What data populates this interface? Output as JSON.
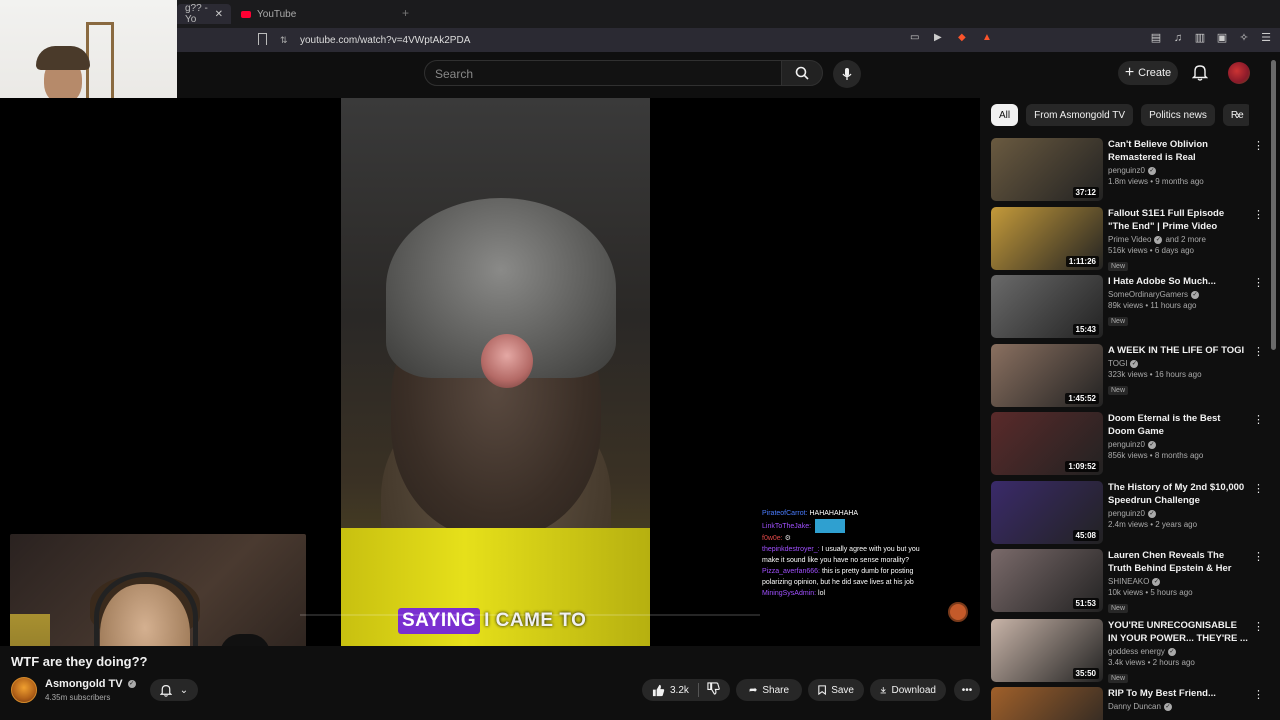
{
  "browser": {
    "tabs": [
      {
        "label": "g?? - Yo",
        "active": true
      },
      {
        "label": "YouTube",
        "active": false
      }
    ],
    "url": "youtube.com/watch?v=4VWptAk2PDA"
  },
  "header": {
    "search_placeholder": "Search",
    "create_label": "Create"
  },
  "video": {
    "caption_highlight": "SAYING",
    "caption_rest": "I CAME TO",
    "title": "WTF are they doing??",
    "channel": "Asmongold TV",
    "subscribers": "4.35m subscribers",
    "likes": "3.2k",
    "share_label": "Share",
    "save_label": "Save",
    "download_label": "Download"
  },
  "chat": [
    {
      "user": "PirateofCarrot:",
      "msg": "HAHAHAHAHA",
      "color": "purple"
    },
    {
      "user": "LinkToTheJake:",
      "msg": "",
      "color": "purple",
      "emote": true
    },
    {
      "user": "f0w0e:",
      "msg": "",
      "color": "red"
    },
    {
      "user": "thepinkdestroyer_:",
      "msg": "I usually agree with you but you",
      "color": "purple"
    },
    {
      "user": "",
      "msg": "make it sound like you have no sense morality?",
      "color": "purple"
    },
    {
      "user": "Pizza_averfan666:",
      "msg": "this is pretty dumb for posting",
      "color": "purple"
    },
    {
      "user": "",
      "msg": "polarizing opinion, but he did save lives at his job",
      "color": "purple"
    },
    {
      "user": "MiningSysAdmin:",
      "msg": "lol",
      "color": "purple"
    }
  ],
  "chips": [
    "All",
    "From Asmongold TV",
    "Politics news",
    "Re"
  ],
  "recommendations": [
    {
      "title": "Can't Believe Oblivion Remastered is Real",
      "channel": "penguinz0",
      "meta": "1.8m views • 9 months ago",
      "duration": "37:12",
      "badge": "",
      "thumb_color": "#6a5a40"
    },
    {
      "title": "Fallout S1E1 Full Episode \"The End\" | Prime Video",
      "channel": "Prime Video",
      "channel_extra": "and 2 more",
      "meta": "516k views • 6 days ago",
      "duration": "1:11:26",
      "badge": "New",
      "thumb_color": "#c49a3a"
    },
    {
      "title": "I Hate Adobe So Much...",
      "channel": "SomeOrdinaryGamers",
      "meta": "89k views • 11 hours ago",
      "duration": "15:43",
      "badge": "New",
      "thumb_color": "#6a6a6a"
    },
    {
      "title": "A WEEK IN THE LIFE OF TOGI",
      "channel": "TOGI",
      "meta": "323k views • 16 hours ago",
      "duration": "1:45:52",
      "badge": "New",
      "thumb_color": "#8a7060"
    },
    {
      "title": "Doom Eternal is the Best Doom Game",
      "channel": "penguinz0",
      "meta": "856k views • 8 months ago",
      "duration": "1:09:52",
      "badge": "",
      "thumb_color": "#5a2a2a"
    },
    {
      "title": "The History of My 2nd $10,000 Speedrun Challenge",
      "channel": "penguinz0",
      "meta": "2.4m views • 2 years ago",
      "duration": "45:08",
      "badge": "",
      "thumb_color": "#3a2a6a"
    },
    {
      "title": "Lauren Chen Reveals The Truth Behind Epstein & Her FBI Raid...",
      "channel": "SHINEAKO",
      "meta": "10k views • 5 hours ago",
      "duration": "51:53",
      "badge": "New",
      "thumb_color": "#7a6a6a"
    },
    {
      "title": "YOU'RE UNRECOGNISABLE IN YOUR POWER... THEY'RE ...",
      "channel": "goddess energy",
      "meta": "3.4k views • 2 hours ago",
      "duration": "35:50",
      "badge": "New",
      "thumb_color": "#c8b4a8"
    },
    {
      "title": "RIP To My Best Friend...",
      "channel": "Danny Duncan",
      "meta": "",
      "duration": "",
      "badge": "",
      "thumb_color": "#a0602a"
    }
  ]
}
